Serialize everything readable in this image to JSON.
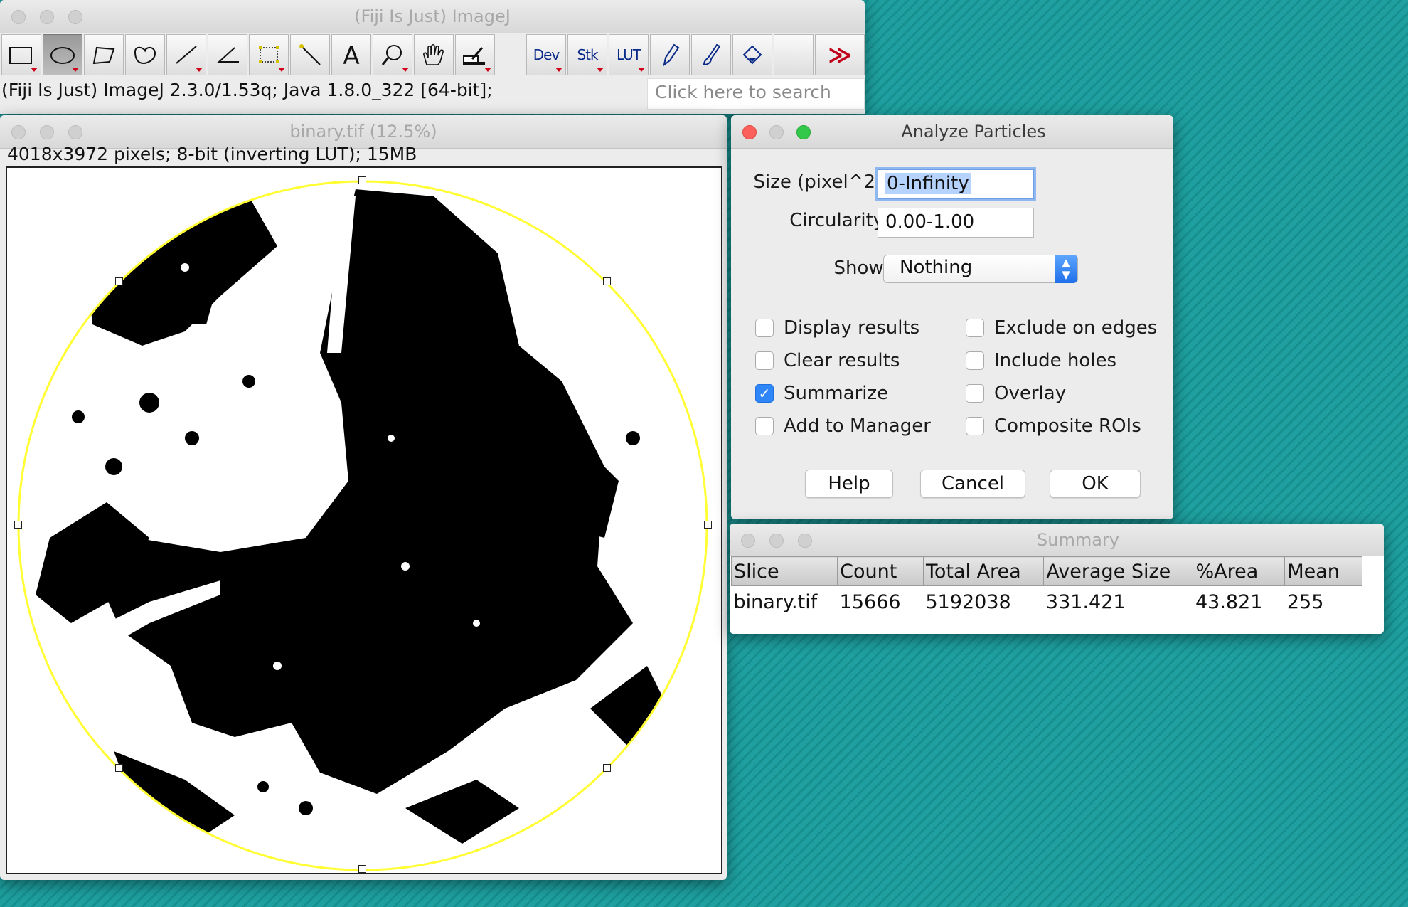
{
  "imagej": {
    "title": "(Fiji Is Just) ImageJ",
    "tools": [
      {
        "name": "rectangle-tool",
        "label": ""
      },
      {
        "name": "oval-tool",
        "label": ""
      },
      {
        "name": "polygon-tool",
        "label": ""
      },
      {
        "name": "freehand-tool",
        "label": ""
      },
      {
        "name": "line-tool",
        "label": ""
      },
      {
        "name": "angle-tool",
        "label": ""
      },
      {
        "name": "multipoint-tool",
        "label": ""
      },
      {
        "name": "wand-tool",
        "label": ""
      },
      {
        "name": "text-tool",
        "label": ""
      },
      {
        "name": "magnifier-tool",
        "label": ""
      },
      {
        "name": "hand-tool",
        "label": ""
      },
      {
        "name": "color-picker-tool",
        "label": ""
      },
      {
        "name": "dev-menu",
        "label": "Dev"
      },
      {
        "name": "stk-menu",
        "label": "Stk"
      },
      {
        "name": "lut-menu",
        "label": "LUT"
      },
      {
        "name": "pencil-tool",
        "label": ""
      },
      {
        "name": "brush-tool",
        "label": ""
      },
      {
        "name": "flood-fill-tool",
        "label": ""
      },
      {
        "name": "empty-slot",
        "label": ""
      },
      {
        "name": "more-tools",
        "label": "≫"
      }
    ],
    "status": "(Fiji Is Just) ImageJ 2.3.0/1.53q; Java 1.8.0_322 [64-bit];",
    "search_placeholder": "Click here to search"
  },
  "image_window": {
    "title": "binary.tif (12.5%)",
    "info": "4018x3972 pixels; 8-bit (inverting LUT); 15MB",
    "roi_color": "#ffff33"
  },
  "analyze": {
    "title": "Analyze Particles",
    "size_label": "Size (pixel^2):",
    "size_value": "0-Infinity",
    "circ_label": "Circularity:",
    "circ_value": "0.00-1.00",
    "show_label": "Show:",
    "show_value": "Nothing",
    "checks_left": [
      {
        "label": "Display results",
        "checked": false
      },
      {
        "label": "Clear results",
        "checked": false
      },
      {
        "label": "Summarize",
        "checked": true
      },
      {
        "label": "Add to Manager",
        "checked": false
      }
    ],
    "checks_right": [
      {
        "label": "Exclude on edges",
        "checked": false
      },
      {
        "label": "Include holes",
        "checked": false
      },
      {
        "label": "Overlay",
        "checked": false
      },
      {
        "label": "Composite ROIs",
        "checked": false
      }
    ],
    "help": "Help",
    "cancel": "Cancel",
    "ok": "OK"
  },
  "summary": {
    "title": "Summary",
    "columns": [
      "Slice",
      "Count",
      "Total Area",
      "Average Size",
      "%Area",
      "Mean"
    ],
    "rows": [
      [
        "binary.tif",
        "15666",
        "5192038",
        "331.421",
        "43.821",
        "255"
      ]
    ]
  }
}
